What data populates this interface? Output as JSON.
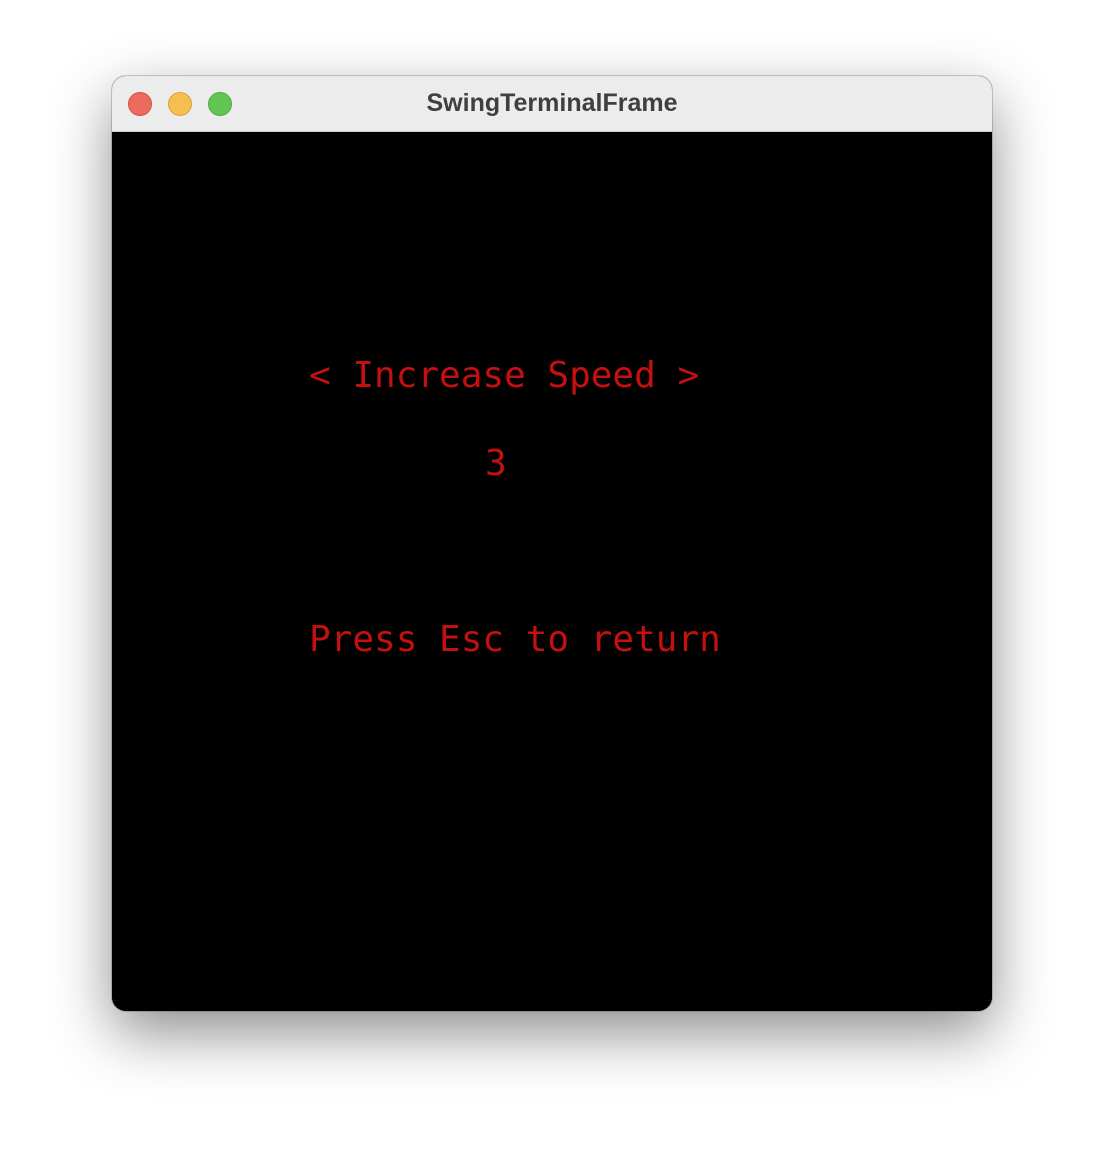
{
  "window": {
    "title": "SwingTerminalFrame",
    "controls": {
      "close": "close-button",
      "minimize": "minimize-button",
      "zoom": "zoom-button"
    }
  },
  "terminal": {
    "menu_option": "< Increase Speed >",
    "value": "3",
    "hint": "Press Esc to return",
    "text_color": "#c4100f",
    "background_color": "#000000"
  }
}
